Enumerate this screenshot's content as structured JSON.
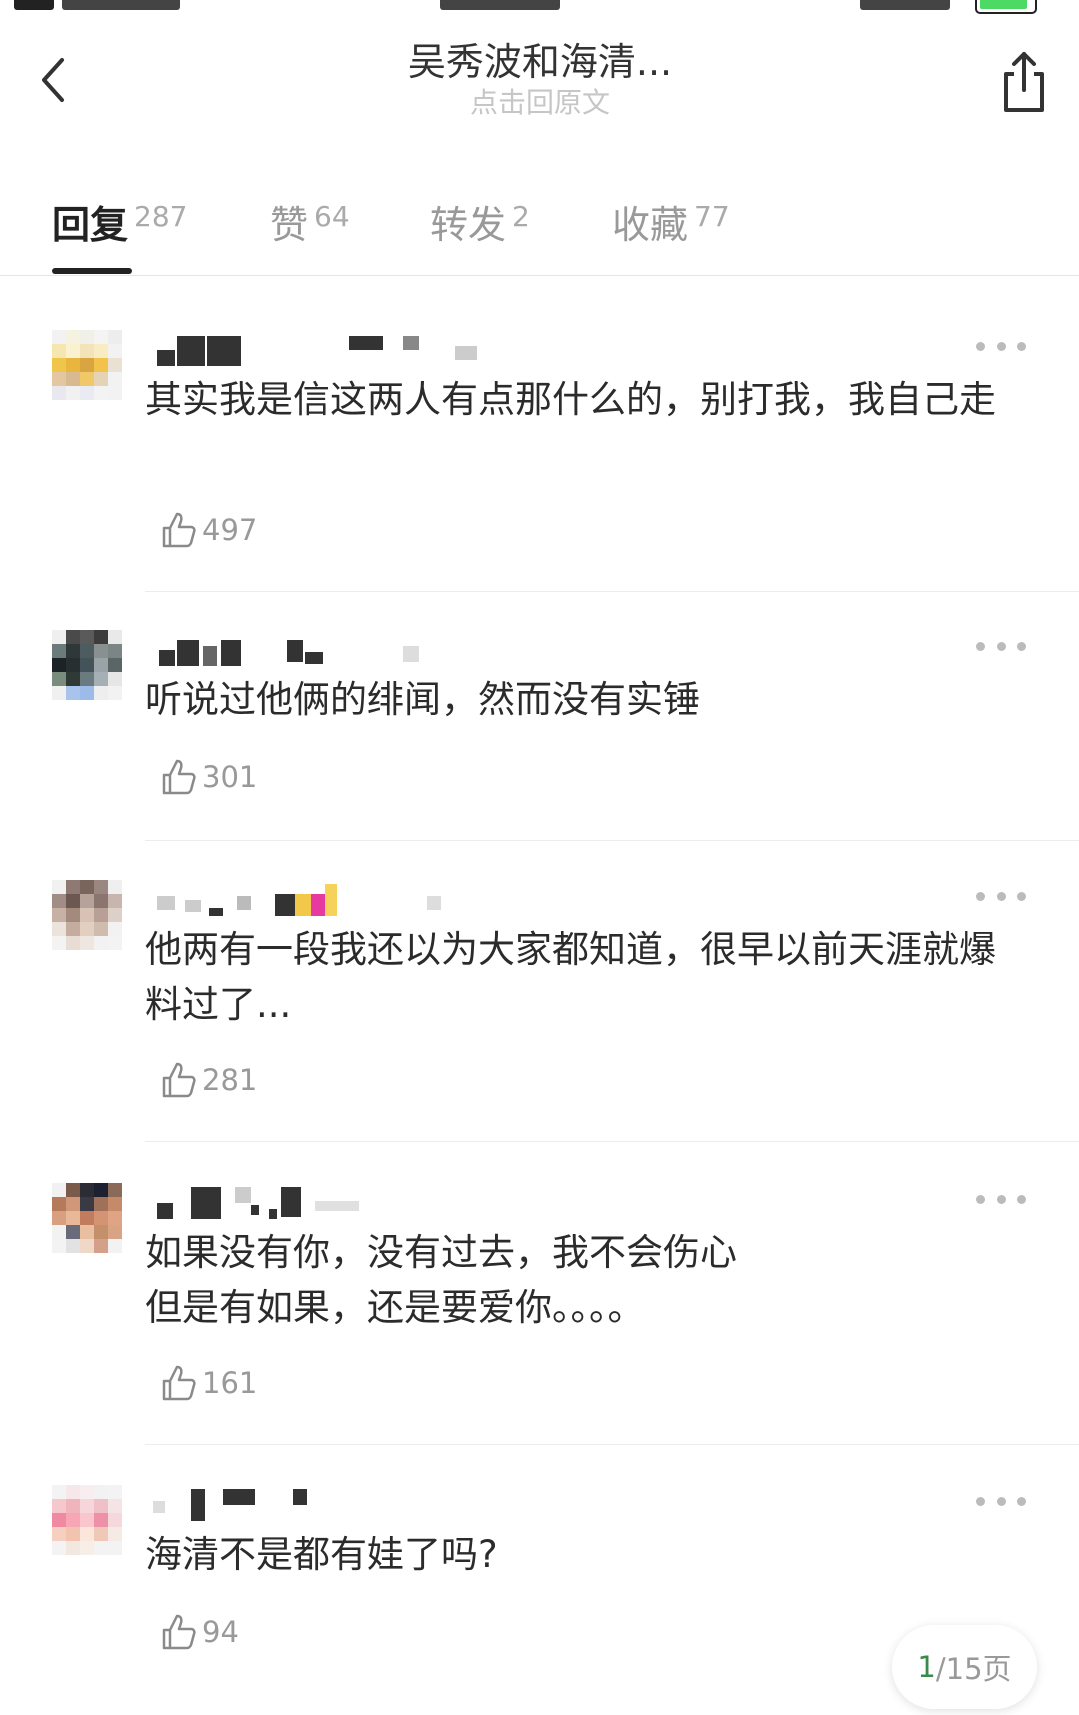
{
  "colors": {
    "accent": "#3a8a4a",
    "text": "#2b2b2b",
    "muted": "#999999",
    "battery": "#4cd964"
  },
  "header": {
    "title": "吴秀波和海清...",
    "subtitle": "点击回原文",
    "back_icon": "chevron-left-icon",
    "share_icon": "share-icon"
  },
  "tabs": [
    {
      "label": "回复",
      "count": "287",
      "active": true
    },
    {
      "label": "赞",
      "count": "64"
    },
    {
      "label": "转发",
      "count": "2"
    },
    {
      "label": "收藏",
      "count": "77"
    }
  ],
  "comments": [
    {
      "text": "其实我是信这两人有点那什么的，别打我，我自己走",
      "likes": "497"
    },
    {
      "text": "听说过他俩的绯闻，然而没有实锤",
      "likes": "301"
    },
    {
      "text": "他两有一段我还以为大家都知道，很早以前天涯就爆料过了...",
      "likes": "281"
    },
    {
      "text": "如果没有你，没有过去，我不会伤心\n但是有如果，还是要爱你。。。。",
      "likes": "161"
    },
    {
      "text": "海清不是都有娃了吗?",
      "likes": "94"
    }
  ],
  "pager": {
    "current": "1",
    "total": "/15页"
  }
}
